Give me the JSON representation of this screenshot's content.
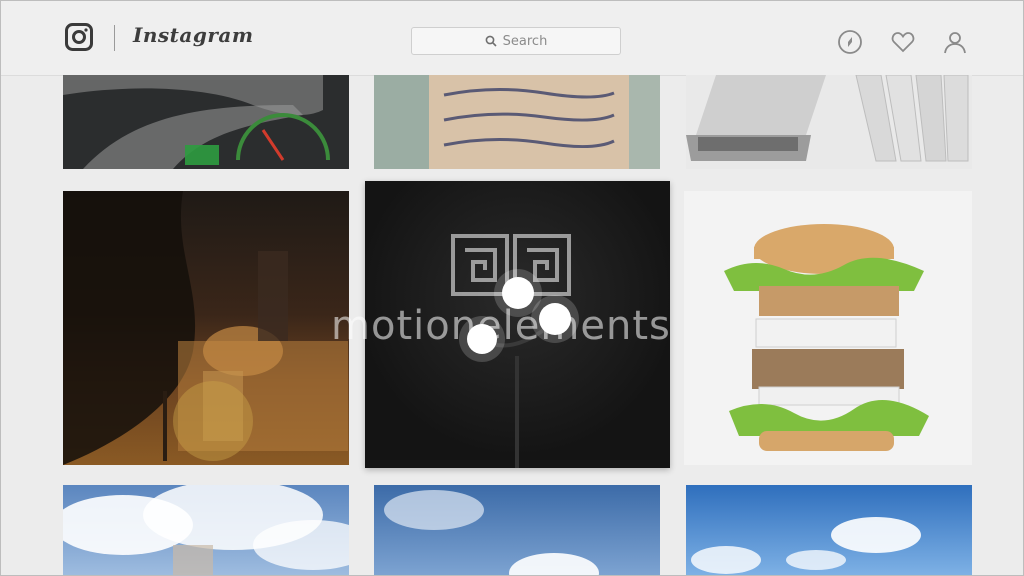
{
  "app": {
    "wordmark": "Instagram",
    "logo_icon": "instagram-camera-icon"
  },
  "header": {
    "search_placeholder": "Search",
    "icons": [
      "compass-icon",
      "heart-icon",
      "user-icon"
    ]
  },
  "grid": {
    "tiles": [
      {
        "subject": "speedometer-photo"
      },
      {
        "subject": "sticky-note-photo"
      },
      {
        "subject": "laptop-books-photo"
      },
      {
        "subject": "church-at-night-photo"
      },
      {
        "subject": "street-lamp-photo"
      },
      {
        "subject": "book-burger-photo"
      },
      {
        "subject": "clouds-photo"
      },
      {
        "subject": "sky-photo"
      },
      {
        "subject": "blue-sky-photo"
      }
    ]
  },
  "watermark": {
    "text": "motionelements"
  },
  "colors": {
    "background": "#ececec",
    "header": "#efefef",
    "icon": "#8a8a8a"
  }
}
